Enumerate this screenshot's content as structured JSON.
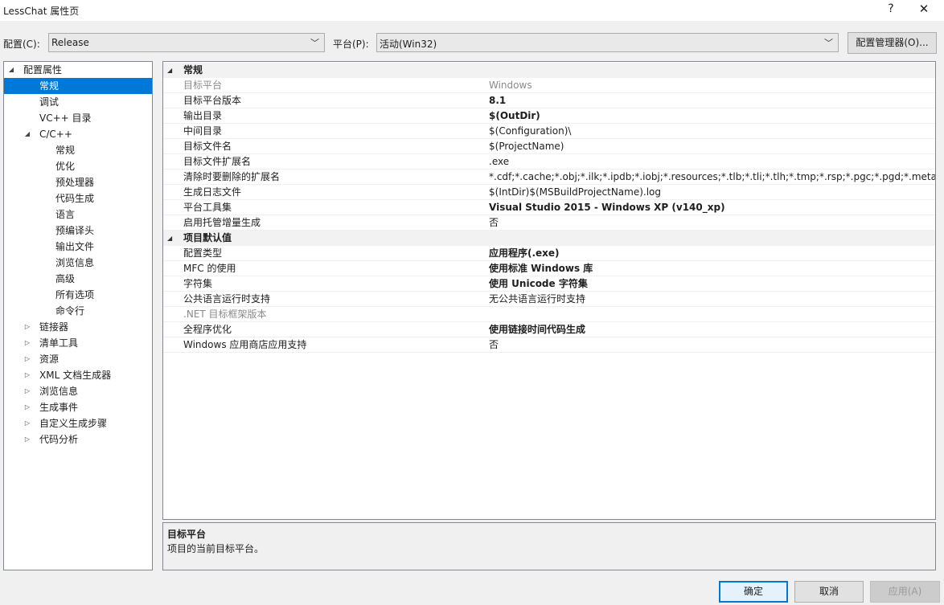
{
  "window": {
    "title": "LessChat 属性页",
    "help": "?",
    "close": "✕"
  },
  "toolbar": {
    "config_label": "配置(C):",
    "config_value": "Release",
    "platform_label": "平台(P):",
    "platform_value": "活动(Win32)",
    "config_manager": "配置管理器(O)..."
  },
  "tree": [
    {
      "label": "配置属性",
      "level": 0,
      "expander": "◢",
      "selected": false
    },
    {
      "label": "常规",
      "level": 1,
      "expander": "",
      "selected": true
    },
    {
      "label": "调试",
      "level": 1,
      "expander": "",
      "selected": false
    },
    {
      "label": "VC++ 目录",
      "level": 1,
      "expander": "",
      "selected": false
    },
    {
      "label": "C/C++",
      "level": 1,
      "expander": "◢",
      "selected": false
    },
    {
      "label": "常规",
      "level": 2,
      "expander": "",
      "selected": false
    },
    {
      "label": "优化",
      "level": 2,
      "expander": "",
      "selected": false
    },
    {
      "label": "预处理器",
      "level": 2,
      "expander": "",
      "selected": false
    },
    {
      "label": "代码生成",
      "level": 2,
      "expander": "",
      "selected": false
    },
    {
      "label": "语言",
      "level": 2,
      "expander": "",
      "selected": false
    },
    {
      "label": "预编译头",
      "level": 2,
      "expander": "",
      "selected": false
    },
    {
      "label": "输出文件",
      "level": 2,
      "expander": "",
      "selected": false
    },
    {
      "label": "浏览信息",
      "level": 2,
      "expander": "",
      "selected": false
    },
    {
      "label": "高级",
      "level": 2,
      "expander": "",
      "selected": false
    },
    {
      "label": "所有选项",
      "level": 2,
      "expander": "",
      "selected": false
    },
    {
      "label": "命令行",
      "level": 2,
      "expander": "",
      "selected": false
    },
    {
      "label": "链接器",
      "level": 1,
      "expander": "▷",
      "selected": false
    },
    {
      "label": "清单工具",
      "level": 1,
      "expander": "▷",
      "selected": false
    },
    {
      "label": "资源",
      "level": 1,
      "expander": "▷",
      "selected": false
    },
    {
      "label": "XML 文档生成器",
      "level": 1,
      "expander": "▷",
      "selected": false
    },
    {
      "label": "浏览信息",
      "level": 1,
      "expander": "▷",
      "selected": false
    },
    {
      "label": "生成事件",
      "level": 1,
      "expander": "▷",
      "selected": false
    },
    {
      "label": "自定义生成步骤",
      "level": 1,
      "expander": "▷",
      "selected": false
    },
    {
      "label": "代码分析",
      "level": 1,
      "expander": "▷",
      "selected": false
    }
  ],
  "grid": [
    {
      "type": "category",
      "label": "常规",
      "expander": "◢"
    },
    {
      "type": "prop",
      "key": "目标平台",
      "value": "Windows",
      "bold": false,
      "disabled": true
    },
    {
      "type": "prop",
      "key": "目标平台版本",
      "value": "8.1",
      "bold": true,
      "disabled": false
    },
    {
      "type": "prop",
      "key": "输出目录",
      "value": "$(OutDir)",
      "bold": true,
      "disabled": false
    },
    {
      "type": "prop",
      "key": "中间目录",
      "value": "$(Configuration)\\",
      "bold": false,
      "disabled": false
    },
    {
      "type": "prop",
      "key": "目标文件名",
      "value": "$(ProjectName)",
      "bold": false,
      "disabled": false
    },
    {
      "type": "prop",
      "key": "目标文件扩展名",
      "value": ".exe",
      "bold": false,
      "disabled": false
    },
    {
      "type": "prop",
      "key": "清除时要删除的扩展名",
      "value": "*.cdf;*.cache;*.obj;*.ilk;*.ipdb;*.iobj;*.resources;*.tlb;*.tli;*.tlh;*.tmp;*.rsp;*.pgc;*.pgd;*.meta;*.tlog;*.manifest;*.res;*.pch;*.exp;*.idb;*.rep;*.xdc;*.pdb",
      "bold": false,
      "disabled": false
    },
    {
      "type": "prop",
      "key": "生成日志文件",
      "value": "$(IntDir)$(MSBuildProjectName).log",
      "bold": false,
      "disabled": false
    },
    {
      "type": "prop",
      "key": "平台工具集",
      "value": "Visual Studio 2015 - Windows XP (v140_xp)",
      "bold": true,
      "disabled": false
    },
    {
      "type": "prop",
      "key": "启用托管增量生成",
      "value": "否",
      "bold": false,
      "disabled": false
    },
    {
      "type": "category",
      "label": "项目默认值",
      "expander": "◢"
    },
    {
      "type": "prop",
      "key": "配置类型",
      "value": "应用程序(.exe)",
      "bold": true,
      "disabled": false
    },
    {
      "type": "prop",
      "key": "MFC 的使用",
      "value": "使用标准 Windows 库",
      "bold": true,
      "disabled": false
    },
    {
      "type": "prop",
      "key": "字符集",
      "value": "使用 Unicode 字符集",
      "bold": true,
      "disabled": false
    },
    {
      "type": "prop",
      "key": "公共语言运行时支持",
      "value": "无公共语言运行时支持",
      "bold": false,
      "disabled": false
    },
    {
      "type": "prop",
      "key": ".NET 目标框架版本",
      "value": "",
      "bold": false,
      "disabled": true
    },
    {
      "type": "prop",
      "key": "全程序优化",
      "value": "使用链接时间代码生成",
      "bold": true,
      "disabled": false
    },
    {
      "type": "prop",
      "key": "Windows 应用商店应用支持",
      "value": "否",
      "bold": false,
      "disabled": false
    }
  ],
  "description": {
    "title": "目标平台",
    "text": "项目的当前目标平台。"
  },
  "buttons": {
    "ok": "确定",
    "cancel": "取消",
    "apply": "应用(A)"
  },
  "icons": {
    "combo_arrow": "chevron-down-icon"
  }
}
